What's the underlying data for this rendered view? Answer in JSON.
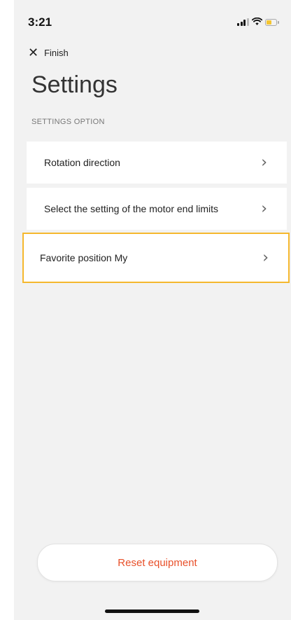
{
  "status_bar": {
    "time": "3:21"
  },
  "header": {
    "close_label": "Finish",
    "title": "Settings",
    "section_label": "SETTINGS OPTION"
  },
  "options": [
    {
      "label": "Rotation direction"
    },
    {
      "label": "Select the setting of the motor end limits"
    },
    {
      "label": "Favorite position My"
    }
  ],
  "footer": {
    "reset_label": "Reset equipment"
  },
  "colors": {
    "accent": "#e8502a",
    "highlight": "#f5b82e",
    "background": "#f2f2f2"
  }
}
